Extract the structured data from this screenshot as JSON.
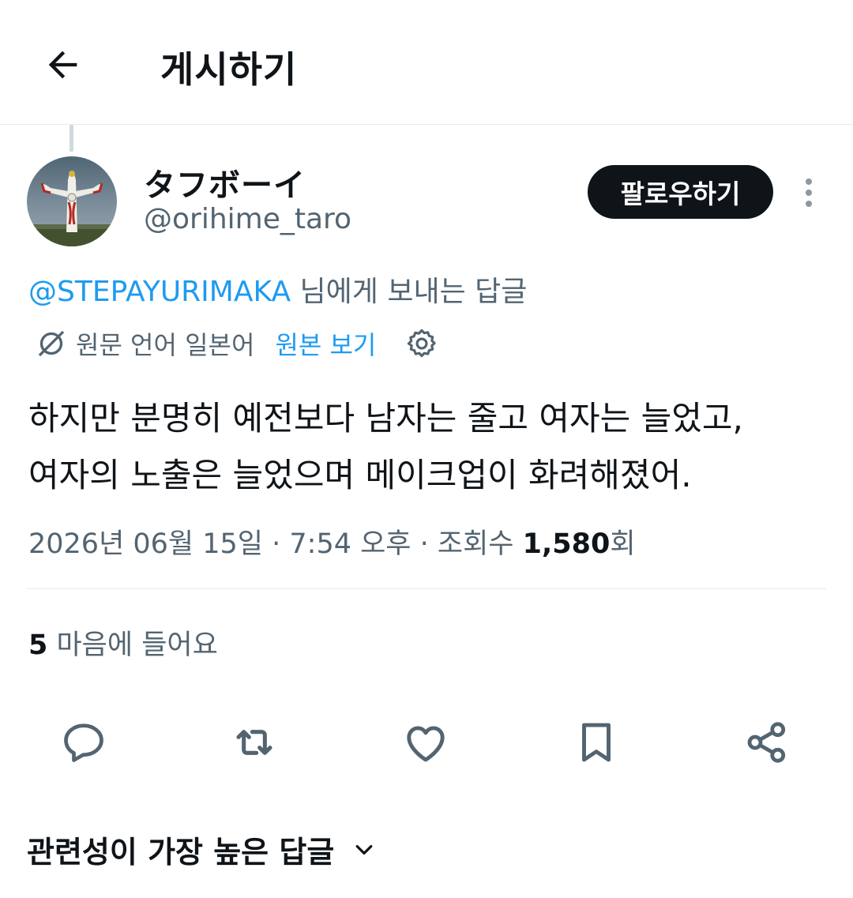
{
  "header": {
    "title": "게시하기",
    "back_icon": "arrow-left-icon"
  },
  "author": {
    "display_name": "タフボーイ",
    "handle": "@orihime_taro",
    "avatar": "avatar-tower-of-the-sun"
  },
  "follow_button": {
    "label": "팔로우하기"
  },
  "reply_to": {
    "mention": "@STEPAYURIMAKA",
    "suffix": " 님에게 보내는 답글"
  },
  "translation": {
    "icon": "translate-icon",
    "source_label": "원문 언어 일본어",
    "show_original": "원본 보기",
    "settings_icon": "gear-icon"
  },
  "post": {
    "line1": "하지만 분명히 예전보다 남자는 줄고 여자는 늘었고,",
    "line2": "여자의 노출은 늘었으며 메이크업이 화려해졌어."
  },
  "meta": {
    "date": "2026년 06월 15일",
    "sep1": " · ",
    "time": "7:54 오후",
    "sep2": " · ",
    "views_prefix": "조회수 ",
    "views": "1,580",
    "views_suffix": "회"
  },
  "likes": {
    "count": "5",
    "label": " 마음에 들어요"
  },
  "actions": [
    "reply-icon",
    "retweet-icon",
    "like-icon",
    "bookmark-icon",
    "share-icon"
  ],
  "sort": {
    "label": "관련성이 가장 높은 답글",
    "icon": "chevron-down-icon"
  },
  "colors": {
    "text": "#0f1419",
    "secondary": "#536471",
    "link": "#1d9bf0",
    "divider": "#e6e9eb"
  }
}
